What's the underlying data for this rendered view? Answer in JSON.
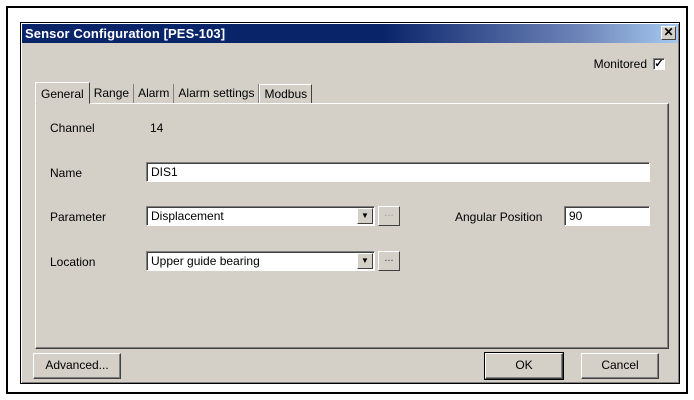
{
  "window": {
    "title": "Sensor Configuration [PES-103]",
    "close_glyph": "✕"
  },
  "monitored": {
    "label": "Monitored",
    "checked": true,
    "check_glyph": "✓"
  },
  "tabs": [
    {
      "label": "General",
      "active": true
    },
    {
      "label": "Range"
    },
    {
      "label": "Alarm"
    },
    {
      "label": "Alarm settings"
    },
    {
      "label": "Modbus"
    }
  ],
  "general": {
    "channel_label": "Channel",
    "channel_value": "14",
    "name_label": "Name",
    "name_value": "DIS1",
    "parameter_label": "Parameter",
    "parameter_value": "Displacement",
    "angular_position_label": "Angular Position",
    "angular_position_value": "90",
    "location_label": "Location",
    "location_value": "Upper guide bearing",
    "ellipsis": "...",
    "dropdown_glyph": "▼"
  },
  "buttons": {
    "advanced": "Advanced...",
    "ok": "OK",
    "cancel": "Cancel"
  }
}
